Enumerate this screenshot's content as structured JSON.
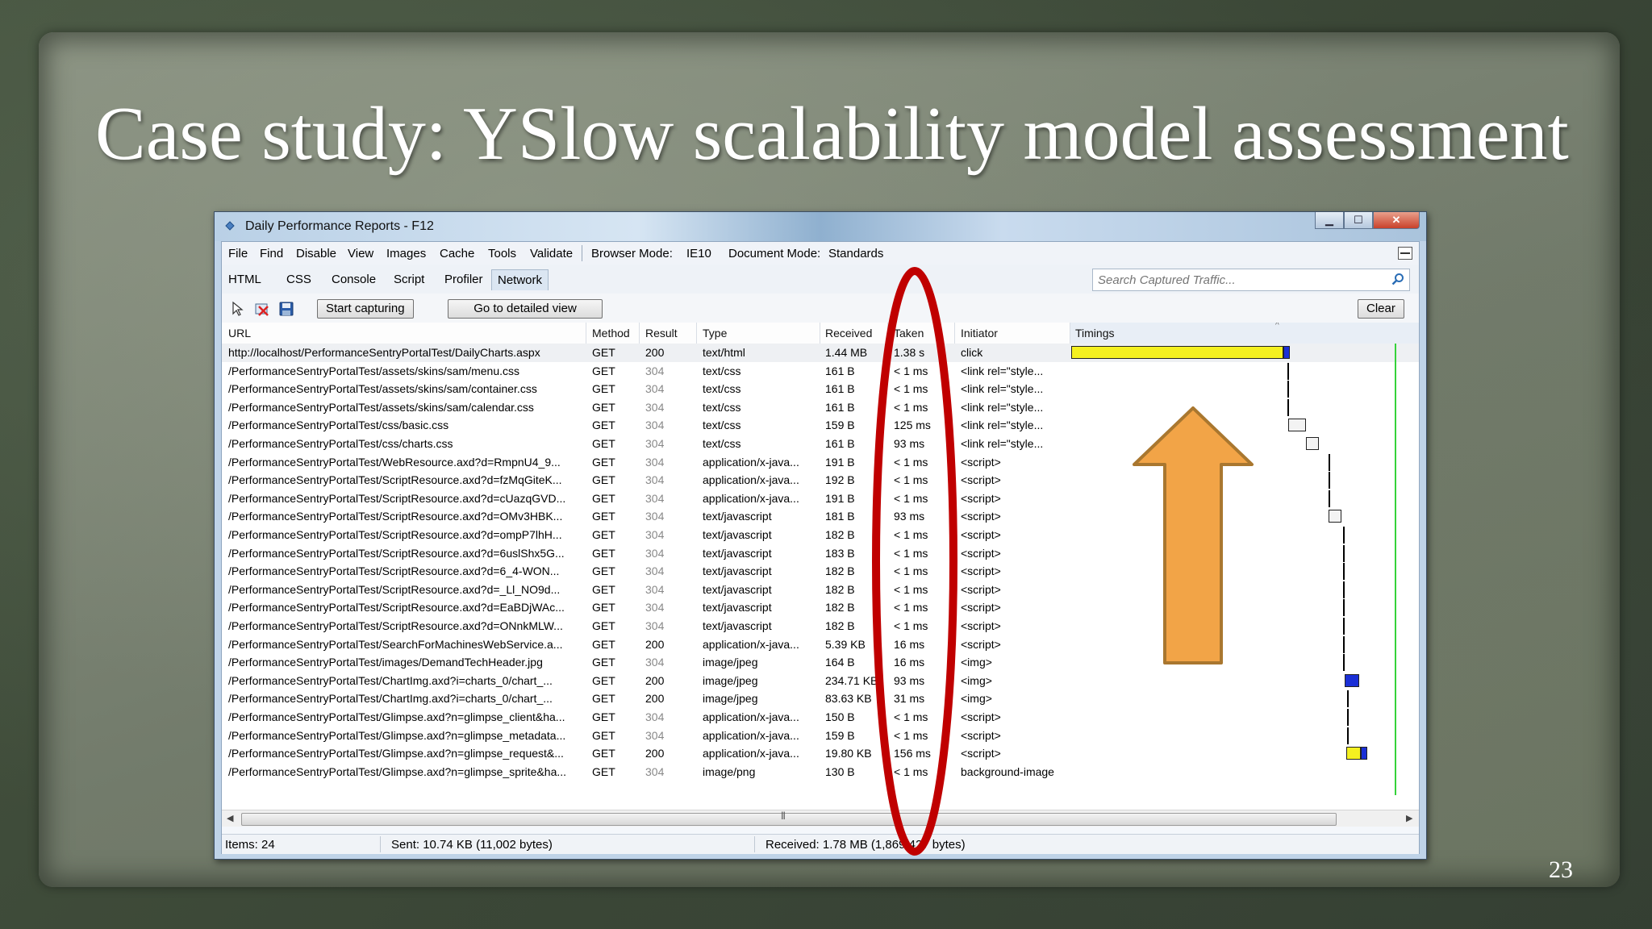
{
  "slide": {
    "title": "Case study: YSlow scalability model assessment",
    "page_number": "23"
  },
  "window": {
    "title": "Daily Performance Reports - F12",
    "minimize": "▁",
    "maximize": "☐",
    "close": "✕"
  },
  "menu": {
    "items": [
      "File",
      "Find",
      "Disable",
      "View",
      "Images",
      "Cache",
      "Tools",
      "Validate"
    ],
    "browser_mode_label": "Browser Mode:",
    "browser_mode_value": "IE10",
    "document_mode_label": "Document Mode:",
    "document_mode_value": "Standards"
  },
  "tabs": [
    "HTML",
    "CSS",
    "Console",
    "Script",
    "Profiler",
    "Network"
  ],
  "active_tab": "Network",
  "search": {
    "placeholder": "Search Captured Traffic..."
  },
  "toolbar": {
    "start_capturing": "Start capturing",
    "detailed_view": "Go to detailed view",
    "clear": "Clear"
  },
  "columns": [
    "URL",
    "Method",
    "Result",
    "Type",
    "Received",
    "Taken",
    "Initiator",
    "Timings"
  ],
  "rows": [
    {
      "url": "http://localhost/PerformanceSentryPortalTest/DailyCharts.aspx",
      "method": "GET",
      "result": "200",
      "type": "text/html",
      "received": "1.44 MB",
      "taken": "1.38 s",
      "initiator": "click"
    },
    {
      "url": "/PerformanceSentryPortalTest/assets/skins/sam/menu.css",
      "method": "GET",
      "result": "304",
      "type": "text/css",
      "received": "161 B",
      "taken": "< 1 ms",
      "initiator": "<link rel=\"style..."
    },
    {
      "url": "/PerformanceSentryPortalTest/assets/skins/sam/container.css",
      "method": "GET",
      "result": "304",
      "type": "text/css",
      "received": "161 B",
      "taken": "< 1 ms",
      "initiator": "<link rel=\"style..."
    },
    {
      "url": "/PerformanceSentryPortalTest/assets/skins/sam/calendar.css",
      "method": "GET",
      "result": "304",
      "type": "text/css",
      "received": "161 B",
      "taken": "< 1 ms",
      "initiator": "<link rel=\"style..."
    },
    {
      "url": "/PerformanceSentryPortalTest/css/basic.css",
      "method": "GET",
      "result": "304",
      "type": "text/css",
      "received": "159 B",
      "taken": "125 ms",
      "initiator": "<link rel=\"style..."
    },
    {
      "url": "/PerformanceSentryPortalTest/css/charts.css",
      "method": "GET",
      "result": "304",
      "type": "text/css",
      "received": "161 B",
      "taken": "93 ms",
      "initiator": "<link rel=\"style..."
    },
    {
      "url": "/PerformanceSentryPortalTest/WebResource.axd?d=RmpnU4_9...",
      "method": "GET",
      "result": "304",
      "type": "application/x-java...",
      "received": "191 B",
      "taken": "< 1 ms",
      "initiator": "<script>"
    },
    {
      "url": "/PerformanceSentryPortalTest/ScriptResource.axd?d=fzMqGiteK...",
      "method": "GET",
      "result": "304",
      "type": "application/x-java...",
      "received": "192 B",
      "taken": "< 1 ms",
      "initiator": "<script>"
    },
    {
      "url": "/PerformanceSentryPortalTest/ScriptResource.axd?d=cUazqGVD...",
      "method": "GET",
      "result": "304",
      "type": "application/x-java...",
      "received": "191 B",
      "taken": "< 1 ms",
      "initiator": "<script>"
    },
    {
      "url": "/PerformanceSentryPortalTest/ScriptResource.axd?d=OMv3HBK...",
      "method": "GET",
      "result": "304",
      "type": "text/javascript",
      "received": "181 B",
      "taken": "93 ms",
      "initiator": "<script>"
    },
    {
      "url": "/PerformanceSentryPortalTest/ScriptResource.axd?d=ompP7lhH...",
      "method": "GET",
      "result": "304",
      "type": "text/javascript",
      "received": "182 B",
      "taken": "< 1 ms",
      "initiator": "<script>"
    },
    {
      "url": "/PerformanceSentryPortalTest/ScriptResource.axd?d=6uslShx5G...",
      "method": "GET",
      "result": "304",
      "type": "text/javascript",
      "received": "183 B",
      "taken": "< 1 ms",
      "initiator": "<script>"
    },
    {
      "url": "/PerformanceSentryPortalTest/ScriptResource.axd?d=6_4-WON...",
      "method": "GET",
      "result": "304",
      "type": "text/javascript",
      "received": "182 B",
      "taken": "< 1 ms",
      "initiator": "<script>"
    },
    {
      "url": "/PerformanceSentryPortalTest/ScriptResource.axd?d=_Ll_NO9d...",
      "method": "GET",
      "result": "304",
      "type": "text/javascript",
      "received": "182 B",
      "taken": "< 1 ms",
      "initiator": "<script>"
    },
    {
      "url": "/PerformanceSentryPortalTest/ScriptResource.axd?d=EaBDjWAc...",
      "method": "GET",
      "result": "304",
      "type": "text/javascript",
      "received": "182 B",
      "taken": "< 1 ms",
      "initiator": "<script>"
    },
    {
      "url": "/PerformanceSentryPortalTest/ScriptResource.axd?d=ONnkMLW...",
      "method": "GET",
      "result": "304",
      "type": "text/javascript",
      "received": "182 B",
      "taken": "< 1 ms",
      "initiator": "<script>"
    },
    {
      "url": "/PerformanceSentryPortalTest/SearchForMachinesWebService.a...",
      "method": "GET",
      "result": "200",
      "type": "application/x-java...",
      "received": "5.39 KB",
      "taken": "16 ms",
      "initiator": "<script>"
    },
    {
      "url": "/PerformanceSentryPortalTest/images/DemandTechHeader.jpg",
      "method": "GET",
      "result": "304",
      "type": "image/jpeg",
      "received": "164 B",
      "taken": "16 ms",
      "initiator": "<img>"
    },
    {
      "url": "/PerformanceSentryPortalTest/ChartImg.axd?i=charts_0/chart_...",
      "method": "GET",
      "result": "200",
      "type": "image/jpeg",
      "received": "234.71 KB",
      "taken": "93 ms",
      "initiator": "<img>"
    },
    {
      "url": "/PerformanceSentryPortalTest/ChartImg.axd?i=charts_0/chart_...",
      "method": "GET",
      "result": "200",
      "type": "image/jpeg",
      "received": "83.63 KB",
      "taken": "31 ms",
      "initiator": "<img>"
    },
    {
      "url": "/PerformanceSentryPortalTest/Glimpse.axd?n=glimpse_client&ha...",
      "method": "GET",
      "result": "304",
      "type": "application/x-java...",
      "received": "150 B",
      "taken": "< 1 ms",
      "initiator": "<script>"
    },
    {
      "url": "/PerformanceSentryPortalTest/Glimpse.axd?n=glimpse_metadata...",
      "method": "GET",
      "result": "304",
      "type": "application/x-java...",
      "received": "159 B",
      "taken": "< 1 ms",
      "initiator": "<script>"
    },
    {
      "url": "/PerformanceSentryPortalTest/Glimpse.axd?n=glimpse_request&...",
      "method": "GET",
      "result": "200",
      "type": "application/x-java...",
      "received": "19.80 KB",
      "taken": "156 ms",
      "initiator": "<script>"
    },
    {
      "url": "/PerformanceSentryPortalTest/Glimpse.axd?n=glimpse_sprite&ha...",
      "method": "GET",
      "result": "304",
      "type": "image/png",
      "received": "130 B",
      "taken": "< 1 ms",
      "initiator": "background-image"
    }
  ],
  "status": {
    "items": "Items: 24",
    "sent": "Sent: 10.74 KB (11,002 bytes)",
    "received": "Received: 1.78 MB (1,869,427 bytes)"
  },
  "colors": {
    "annotation_ellipse": "#c00000",
    "annotation_arrow": "#f0a040",
    "timing_wait": "#f4f020",
    "timing_receive": "#1a2fd6",
    "dom_content_line": "#35d23a"
  }
}
